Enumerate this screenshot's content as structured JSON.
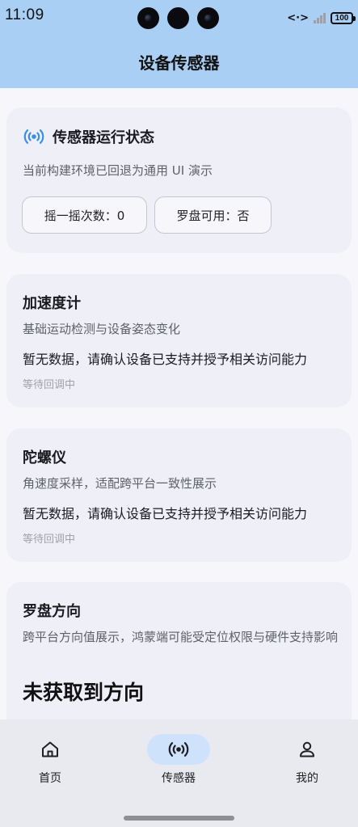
{
  "status_bar": {
    "time": "11:09",
    "data_indicator": "<·>",
    "battery": "100",
    "icons": [
      "front-camera-icon",
      "data-transfer-icon",
      "signal-icon",
      "battery-icon"
    ]
  },
  "header": {
    "title": "设备传感器",
    "background": "#a9cff5"
  },
  "status_card": {
    "icon": "sensor-broadcast-icon",
    "title": "传感器运行状态",
    "description": "当前构建环境已回退为通用 UI 演示",
    "chips": {
      "shake_count": "摇一摇次数：0",
      "compass_available": "罗盘可用：否"
    },
    "accent": "#3c8fe0"
  },
  "sensors": {
    "accelerometer": {
      "title": "加速度计",
      "description": "基础运动检测与设备姿态变化",
      "message": "暂无数据，请确认设备已支持并授予相关访问能力",
      "footer": "等待回调中"
    },
    "gyroscope": {
      "title": "陀螺仪",
      "description": "角速度采样，适配跨平台一致性展示",
      "message": "暂无数据，请确认设备已支持并授予相关访问能力",
      "footer": "等待回调中"
    },
    "compass": {
      "title": "罗盘方向",
      "description": "跨平台方向值展示，鸿蒙端可能受定位权限与硬件支持影响",
      "value": "未获取到方向"
    }
  },
  "bottom_nav": {
    "items": [
      {
        "label": "首页",
        "icon": "home-icon",
        "active": false
      },
      {
        "label": "传感器",
        "icon": "sensor-broadcast-icon",
        "active": true
      },
      {
        "label": "我的",
        "icon": "user-icon",
        "active": false
      }
    ],
    "active_highlight": "#cfe2fb"
  }
}
